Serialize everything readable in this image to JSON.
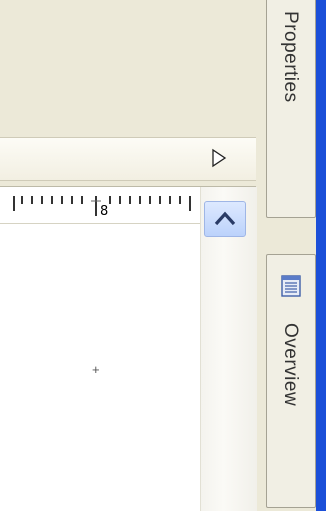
{
  "ruler": {
    "label": "8"
  },
  "side_tabs": [
    {
      "label": "Properties"
    },
    {
      "label": "Overview",
      "icon": "overview-icon"
    }
  ],
  "icons": {
    "play": "play-triangle-icon",
    "scroll_up": "chevron-up-icon",
    "marker": "crosshair-icon"
  },
  "colors": {
    "window_bg": "#ece9d8",
    "scroll_accent": "#bcd2fb",
    "edge": "#1b4fd8"
  }
}
